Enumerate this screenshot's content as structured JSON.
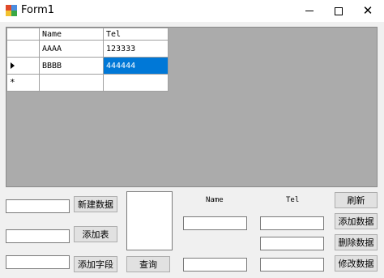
{
  "window": {
    "title": "Form1",
    "icon": "form-app-icon"
  },
  "grid": {
    "columns": [
      "Name",
      "Tel"
    ],
    "rows": [
      {
        "name": "AAAA",
        "tel": "123333"
      },
      {
        "name": "BBBB",
        "tel": "444444"
      }
    ],
    "current_row_marker": "arrow",
    "new_row_marker": "*",
    "selection_color": "#0078d7"
  },
  "buttons": {
    "new_data": "新建数据",
    "add_table": "添加表",
    "add_field": "添加字段",
    "query": "查询",
    "refresh": "刷新",
    "add_data": "添加数据",
    "delete_data": "删除数据",
    "edit_data": "修改数据"
  },
  "labels": {
    "name": "Name",
    "tel": "Tel"
  },
  "inputs": {
    "new_data_value": "",
    "add_table_value": "",
    "add_field_value": "",
    "name_value": "",
    "tel_value": "",
    "delete_value": "",
    "edit_name_value": "",
    "edit_tel_value": ""
  }
}
